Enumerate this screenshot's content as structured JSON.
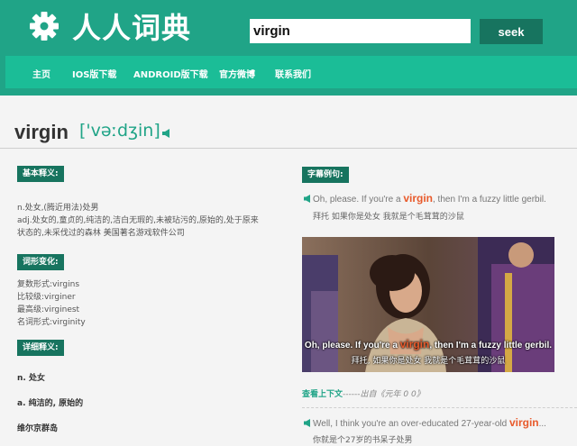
{
  "header": {
    "logo_text": "人人词典",
    "search_value": "virgin",
    "seek_label": "seek"
  },
  "nav": {
    "items": [
      "主页",
      "IOS版下载",
      "ANDROID版下载",
      "官方微博",
      "联系我们"
    ]
  },
  "word": {
    "headword": "virgin",
    "phonetic": "['vəːdʒin]"
  },
  "basic": {
    "label": "基本释义:",
    "lines": [
      "n.处女,(腾近用法)处男",
      "adj.处女的,童贞的,纯洁的,洁白无瑕的,未被玷污的,原始的,处于原来",
      "状态的,未采伐过的森林 美国著名游戏软件公司"
    ]
  },
  "forms": {
    "label": "词形变化:",
    "lines": [
      "复数形式:virgins",
      "比较级:virginer",
      "最高级:virginest",
      "名词形式:virginity"
    ]
  },
  "detail": {
    "label": "详细释义:",
    "items": [
      "n. 处女",
      "a. 纯洁的, 原始的",
      "维尔京群岛"
    ]
  },
  "subtitles": {
    "label": "字幕例句:",
    "example1": {
      "en_before": "Oh, please. If you're a ",
      "en_word": "virgin",
      "en_after": ", then I'm a fuzzy little gerbil.",
      "cn": "拜托 如果你是处女 我就是个毛茸茸的沙鼠"
    },
    "video": {
      "sub_en_before": "Oh, please. If you're a ",
      "sub_en_word": "virgin",
      "sub_en_after": ", then I'm a fuzzy little gerbil.",
      "sub_cn": "拜托, 如果你是处女 我就是个毛茸茸的沙鼠"
    },
    "context_link": "查看上下文",
    "context_dash": "------",
    "context_source": "出自《元年 0 0》",
    "example2": {
      "en_before": "Well, I think you're an over-educated 27-year-old ",
      "en_word": "virgin",
      "en_after": "...",
      "cn": "你就是个27岁的书呆子处男"
    }
  },
  "colors": {
    "header": "#20a487",
    "nav": "#1bbd97",
    "label_bg": "#17745f",
    "highlight": "#e85a2b"
  }
}
